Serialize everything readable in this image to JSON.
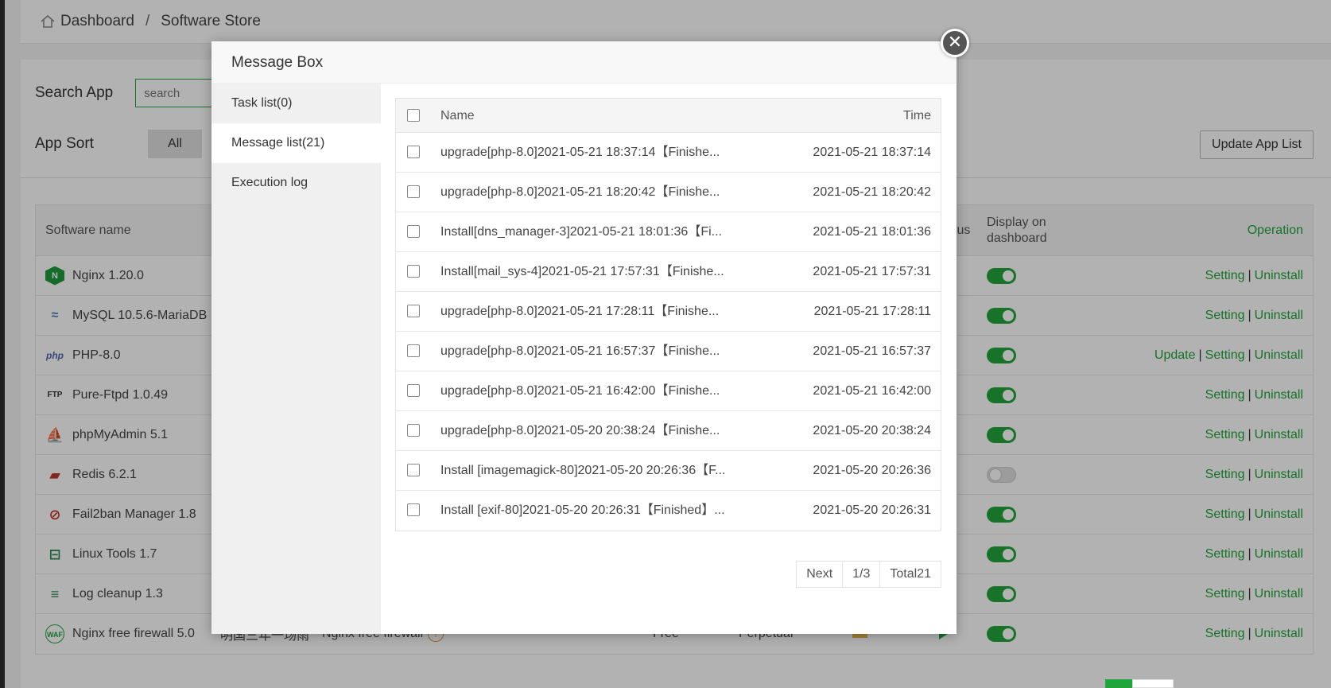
{
  "breadcrumb": {
    "home": "Dashboard",
    "separator": "/",
    "current": "Software Store"
  },
  "search": {
    "label": "Search App",
    "placeholder": "search"
  },
  "sort": {
    "label": "App Sort",
    "all_label": "All"
  },
  "update_list_label": "Update App List",
  "software_table": {
    "headers": {
      "name": "Software name",
      "status": "Status",
      "display": "Display on dashboard",
      "operation": "Operation"
    },
    "rows": [
      {
        "name": "Nginx 1.20.0",
        "icon": "nginx-icon",
        "display_on": true,
        "ops": [
          "Setting",
          "Uninstall"
        ]
      },
      {
        "name": "MySQL 10.5.6-MariaDB",
        "icon": "mysql-icon",
        "display_on": true,
        "ops": [
          "Setting",
          "Uninstall"
        ]
      },
      {
        "name": "PHP-8.0",
        "icon": "php-icon",
        "display_on": true,
        "ops": [
          "Update",
          "Setting",
          "Uninstall"
        ]
      },
      {
        "name": "Pure-Ftpd 1.0.49",
        "icon": "ftp-icon",
        "display_on": true,
        "ops": [
          "Setting",
          "Uninstall"
        ]
      },
      {
        "name": "phpMyAdmin 5.1",
        "icon": "phpmyadmin-icon",
        "display_on": true,
        "ops": [
          "Setting",
          "Uninstall"
        ]
      },
      {
        "name": "Redis 6.2.1",
        "icon": "redis-icon",
        "display_on": false,
        "ops": [
          "Setting",
          "Uninstall"
        ]
      },
      {
        "name": "Fail2ban Manager 1.8",
        "icon": "fail2ban-icon",
        "display_on": true,
        "ops": [
          "Setting",
          "Uninstall"
        ]
      },
      {
        "name": "Linux Tools 1.7",
        "icon": "toolbox-icon",
        "display_on": true,
        "ops": [
          "Setting",
          "Uninstall"
        ]
      },
      {
        "name": "Log cleanup 1.3",
        "icon": "log-icon",
        "display_on": true,
        "ops": [
          "Setting",
          "Uninstall"
        ]
      },
      {
        "name": "Nginx free firewall 5.0",
        "icon": "waf-icon",
        "display_on": true,
        "author": "明国三年一场雨",
        "desc": "Nginx free firewall",
        "price": "Free",
        "expire": "Perpetual",
        "ops": [
          "Setting",
          "Uninstall"
        ]
      }
    ]
  },
  "modal": {
    "title": "Message Box",
    "close_symbol": "✕",
    "side_items": [
      "Task list(0)",
      "Message list(21)",
      "Execution log"
    ],
    "active_index": 1,
    "table": {
      "headers": {
        "name": "Name",
        "time": "Time"
      },
      "rows": [
        {
          "name": "upgrade[php-8.0]2021-05-21 18:37:14【Finishe...",
          "time": "2021-05-21 18:37:14"
        },
        {
          "name": "upgrade[php-8.0]2021-05-21 18:20:42【Finishe...",
          "time": "2021-05-21 18:20:42"
        },
        {
          "name": "Install[dns_manager-3]2021-05-21 18:01:36【Fi...",
          "time": "2021-05-21 18:01:36"
        },
        {
          "name": "Install[mail_sys-4]2021-05-21 17:57:31【Finishe...",
          "time": "2021-05-21 17:57:31"
        },
        {
          "name": "upgrade[php-8.0]2021-05-21 17:28:11【Finishe...",
          "time": "2021-05-21 17:28:11"
        },
        {
          "name": "upgrade[php-8.0]2021-05-21 16:57:37【Finishe...",
          "time": "2021-05-21 16:57:37"
        },
        {
          "name": "upgrade[php-8.0]2021-05-21 16:42:00【Finishe...",
          "time": "2021-05-21 16:42:00"
        },
        {
          "name": "upgrade[php-8.0]2021-05-20 20:38:24【Finishe...",
          "time": "2021-05-20 20:38:24"
        },
        {
          "name": "Install [imagemagick-80]2021-05-20 20:26:36【F...",
          "time": "2021-05-20 20:26:36"
        },
        {
          "name": "Install [exif-80]2021-05-20 20:26:31【Finished】...",
          "time": "2021-05-20 20:26:31"
        }
      ]
    },
    "pager": {
      "next": "Next",
      "page": "1/3",
      "total": "Total21"
    }
  },
  "colors": {
    "accent": "#20a53a",
    "help": "#e69a3a"
  }
}
